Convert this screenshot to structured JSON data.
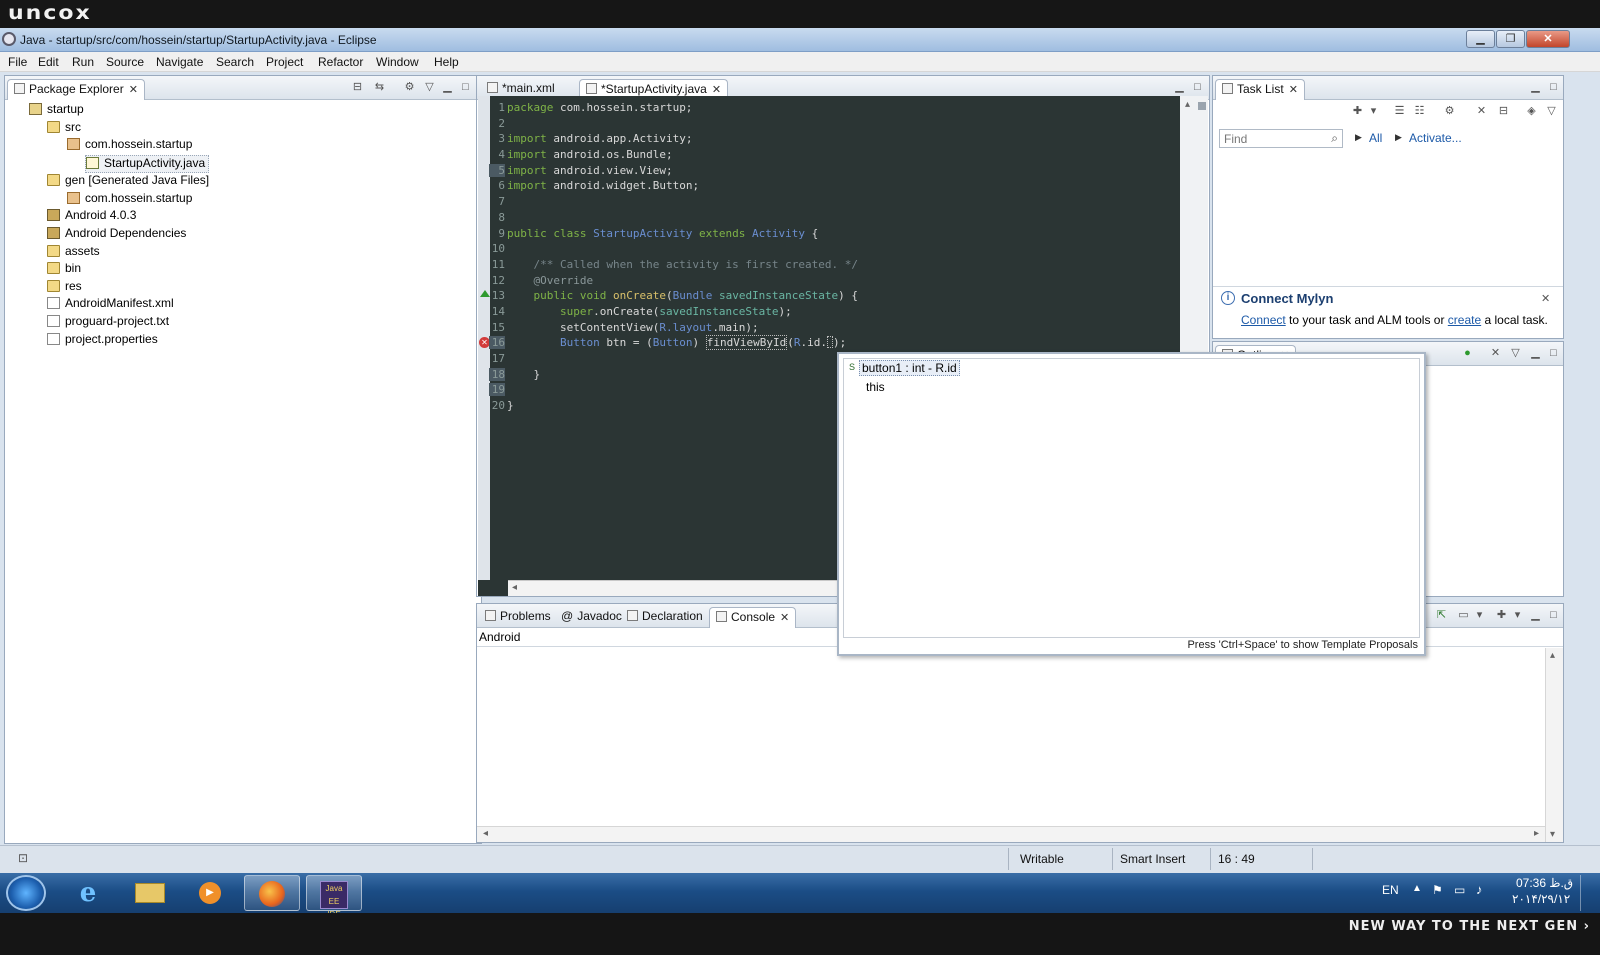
{
  "brand": "uncox",
  "tagline": "NEW WAY TO THE NEXT GEN ›",
  "window": {
    "title": "Java - startup/src/com/hossein/startup/StartupActivity.java - Eclipse"
  },
  "menu": [
    "File",
    "Edit",
    "Run",
    "Source",
    "Navigate",
    "Search",
    "Project",
    "Refactor",
    "Window",
    "Help"
  ],
  "package_explorer": {
    "title": "Package Explorer",
    "items": [
      {
        "label": "startup",
        "icon": "project-icon"
      },
      {
        "label": "src",
        "icon": "source-folder-icon"
      },
      {
        "label": "com.hossein.startup",
        "icon": "package-icon"
      },
      {
        "label": "StartupActivity.java",
        "icon": "java-file-icon"
      },
      {
        "label": "gen [Generated Java Files]",
        "icon": "source-folder-icon"
      },
      {
        "label": "com.hossein.startup",
        "icon": "package-icon"
      },
      {
        "label": "Android 4.0.3",
        "icon": "library-icon"
      },
      {
        "label": "Android Dependencies",
        "icon": "library-icon"
      },
      {
        "label": "assets",
        "icon": "folder-icon"
      },
      {
        "label": "bin",
        "icon": "folder-icon"
      },
      {
        "label": "res",
        "icon": "folder-icon"
      },
      {
        "label": "AndroidManifest.xml",
        "icon": "xml-file-icon"
      },
      {
        "label": "proguard-project.txt",
        "icon": "text-file-icon"
      },
      {
        "label": "project.properties",
        "icon": "text-file-icon"
      }
    ]
  },
  "editor": {
    "tabs": [
      {
        "label": "*main.xml"
      },
      {
        "label": "*StartupActivity.java"
      }
    ],
    "line_numbers": [
      "1",
      "2",
      "3",
      "4",
      "5",
      "6",
      "7",
      "8",
      "9",
      "10",
      "11",
      "12",
      "13",
      "14",
      "15",
      "16",
      "17",
      "18",
      "19",
      "20"
    ],
    "code": {
      "l1a": "package",
      "l1b": " com.hossein.startup;",
      "l3a": "import",
      "l3b": " android.app.Activity;",
      "l4a": "import",
      "l4b": " android.os.Bundle;",
      "l5a": "import",
      "l5b": " android.view.View;",
      "l6a": "import",
      "l6b": " android.widget.Button;",
      "l9a": "public class ",
      "l9b": "StartupActivity",
      "l9c": " extends ",
      "l9d": "Activity",
      "l9e": " {",
      "l11": "    /** Called when the activity is first created. */",
      "l12": "    @Override",
      "l13a": "    public void ",
      "l13b": "onCreate",
      "l13c": "(",
      "l13d": "Bundle",
      "l13e": " savedInstanceState",
      "l13f": ") {",
      "l14a": "        super",
      "l14b": ".onCreate(",
      "l14c": "savedInstanceState",
      "l14d": ");",
      "l15a": "        setContentView(",
      "l15b": "R.layout",
      "l15c": ".main);",
      "l16a": "        ",
      "l16b": "Button",
      "l16c": " btn = (",
      "l16d": "Button",
      "l16e": ") ",
      "l16f": "findViewById",
      "l16g": "(",
      "l16h": "R",
      "l16i": ".id.",
      "l16j": "",
      "l16k": ");",
      "l18": "    }",
      "l20": "}"
    }
  },
  "autocomplete": {
    "proposals": [
      "button1 : int - R.id",
      "this"
    ],
    "hint": "Press 'Ctrl+Space' to show Template Proposals"
  },
  "task_list": {
    "title": "Task List",
    "find_placeholder": "Find",
    "all_label": "All",
    "activate_label": "Activate..."
  },
  "mylyn": {
    "title": "Connect Mylyn",
    "connect_link": "Connect",
    "text1": " to your task and ALM tools or ",
    "create_link": "create",
    "text2": " a local task."
  },
  "outline": {
    "title": "Outline"
  },
  "bottom_panel": {
    "tabs": [
      {
        "label": "Problems"
      },
      {
        "label": "Javadoc"
      },
      {
        "label": "Declaration"
      },
      {
        "label": "Console"
      }
    ],
    "console_label": "Android"
  },
  "status": {
    "mode": "Writable",
    "insert": "Smart Insert",
    "position": "16 : 49"
  },
  "taskbar": {
    "language": "EN",
    "time": "07:36 ق.ظ",
    "date": "۲۰۱۴/۲۹/۱۲",
    "apps": [
      "Internet Explorer",
      "Windows Explorer",
      "Media Player",
      "Firefox",
      "Java EE IDE"
    ]
  }
}
